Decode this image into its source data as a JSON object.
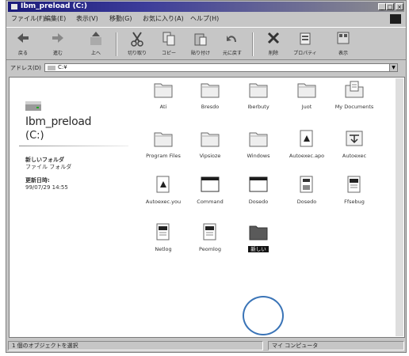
{
  "window": {
    "title": "Ibm_preload (C:)"
  },
  "menu": [
    "ファイル(F)",
    "編集(E)",
    "表示(V)",
    "移動(G)",
    "お気に入り(A)",
    "ヘルプ(H)"
  ],
  "toolbar": [
    "戻る",
    "進む",
    "上へ",
    "切り取り",
    "コピー",
    "貼り付け",
    "元に戻す",
    "削除",
    "プロパティ",
    "表示"
  ],
  "address": {
    "label": "アドレス(D)",
    "value": "C:¥"
  },
  "drive": {
    "title": "Ibm_preload",
    "letter": "(C:)",
    "info_label_1": "新しいフォルダ",
    "info_value_1": "ファイル フォルダ",
    "info_label_2": "更新日時:",
    "info_value_2": "99/07/29 14:55"
  },
  "items": [
    {
      "label": "Ati",
      "type": "folder"
    },
    {
      "label": "Bresdo",
      "type": "folder"
    },
    {
      "label": "Iberbuty",
      "type": "folder"
    },
    {
      "label": "Juot",
      "type": "folder"
    },
    {
      "label": "My Documents",
      "type": "mydocs"
    },
    {
      "label": "Program Files",
      "type": "folder"
    },
    {
      "label": "Vipsioze",
      "type": "folder"
    },
    {
      "label": "Windows",
      "type": "folder"
    },
    {
      "label": "Autoexec.apo",
      "type": "doc"
    },
    {
      "label": "Autoexec",
      "type": "sys"
    },
    {
      "label": "Autoexec.you",
      "type": "doc"
    },
    {
      "label": "Command",
      "type": "window"
    },
    {
      "label": "Dosedo",
      "type": "window"
    },
    {
      "label": "Dosedo",
      "type": "disk"
    },
    {
      "label": "Ffsebug",
      "type": "notepad"
    },
    {
      "label": "Netlog",
      "type": "notepad"
    },
    {
      "label": "Peomlog",
      "type": "notepad"
    },
    {
      "label": "新しい",
      "type": "newfolder"
    }
  ],
  "status": {
    "left": "1 個のオブジェクトを選択",
    "right": "マイ コンピュータ"
  },
  "colors": {
    "title_start": "#1a1a7a",
    "highlight_circle": "#3a74b7",
    "window_face": "#c6c6c6"
  }
}
